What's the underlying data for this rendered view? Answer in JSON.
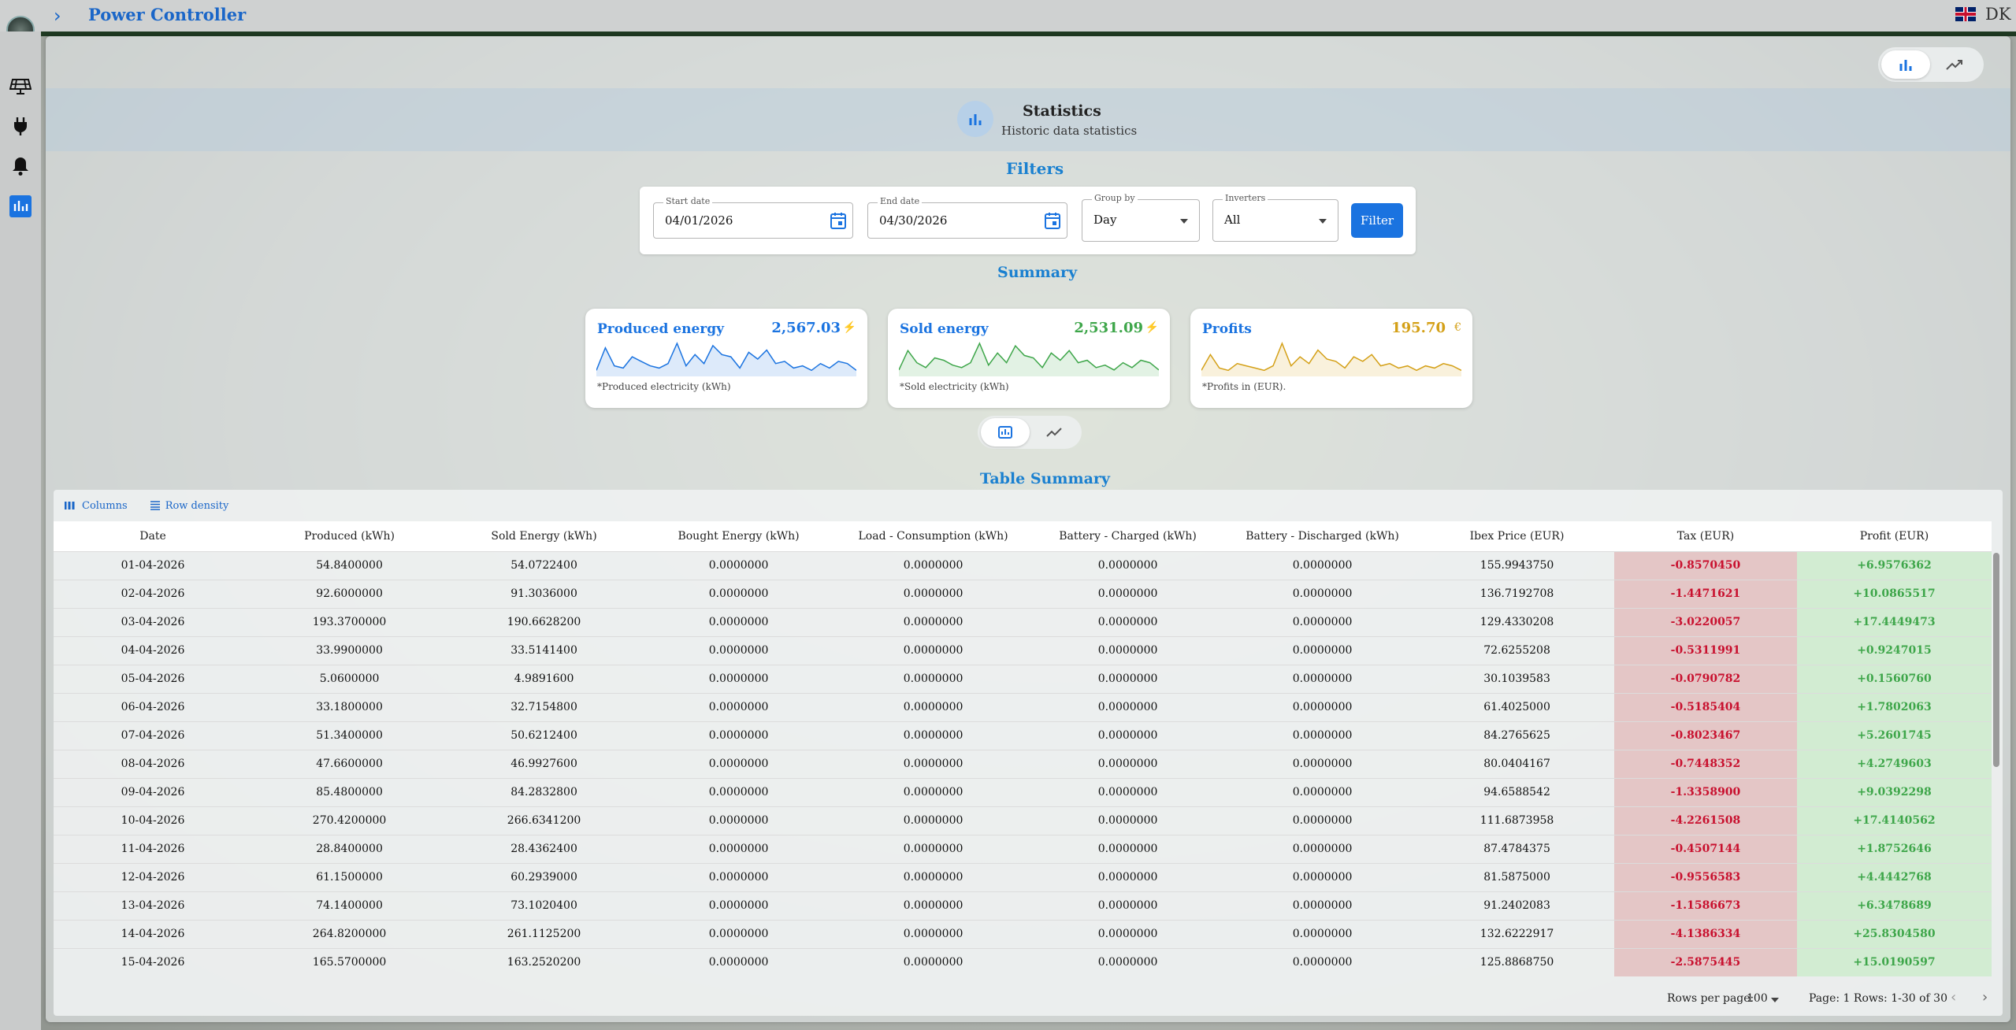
{
  "app": {
    "title": "Power Controller",
    "lang_code": "DK",
    "chevron": "›"
  },
  "sidebar": {
    "items": [
      "solar-panel-icon",
      "plug-icon",
      "bell-icon",
      "bar-chart-icon"
    ]
  },
  "statistics": {
    "title": "Statistics",
    "subtitle": "Historic data statistics"
  },
  "filters": {
    "title": "Filters",
    "start_label": "Start date",
    "start_value": "04/01/2026",
    "end_label": "End date",
    "end_value": "04/30/2026",
    "group_label": "Group by",
    "group_value": "Day",
    "inverters_label": "Inverters",
    "inverters_value": "All",
    "button": "Filter"
  },
  "summary": {
    "title": "Summary",
    "produced": {
      "label": "Produced energy",
      "value": "2,567.03",
      "unit": "⚡",
      "note": "*Produced electricity (kWh)",
      "color": "#1a73e0",
      "spark": [
        2,
        12,
        4,
        3,
        8,
        6,
        4,
        3,
        5,
        14,
        4,
        9,
        5,
        13,
        9,
        8,
        3,
        10,
        7,
        11,
        5,
        6,
        3,
        4,
        2,
        5,
        3,
        6,
        5,
        2
      ]
    },
    "sold": {
      "label": "Sold energy",
      "value": "2,531.09",
      "unit": "⚡",
      "note": "*Sold electricity (kWh)",
      "color": "#3ea64a",
      "spark": [
        2,
        10,
        5,
        3,
        7,
        6,
        4,
        3,
        5,
        13,
        4,
        9,
        5,
        12,
        8,
        7,
        3,
        9,
        6,
        10,
        5,
        6,
        3,
        4,
        2,
        5,
        3,
        6,
        5,
        2
      ]
    },
    "profits": {
      "label": "Profits",
      "value": "195.70",
      "unit": "€",
      "note": "*Profits in (EUR).",
      "color": "#d4a017",
      "spark": [
        2,
        9,
        3,
        2,
        5,
        4,
        3,
        2,
        4,
        14,
        4,
        8,
        5,
        11,
        7,
        6,
        3,
        8,
        6,
        9,
        4,
        5,
        3,
        4,
        2,
        4,
        3,
        5,
        4,
        2
      ]
    }
  },
  "table": {
    "title": "Table Summary",
    "columns_btn": "Columns",
    "density_btn": "Row density",
    "headers": [
      "Date",
      "Produced (kWh)",
      "Sold Energy (kWh)",
      "Bought Energy (kWh)",
      "Load - Consumption (kWh)",
      "Battery - Charged (kWh)",
      "Battery - Discharged (kWh)",
      "Ibex Price (EUR)",
      "Tax (EUR)",
      "Profit (EUR)"
    ],
    "rows": [
      [
        "01-04-2026",
        "54.8400000",
        "54.0722400",
        "0.0000000",
        "0.0000000",
        "0.0000000",
        "0.0000000",
        "155.9943750",
        "-0.8570450",
        "+6.9576362"
      ],
      [
        "02-04-2026",
        "92.6000000",
        "91.3036000",
        "0.0000000",
        "0.0000000",
        "0.0000000",
        "0.0000000",
        "136.7192708",
        "-1.4471621",
        "+10.0865517"
      ],
      [
        "03-04-2026",
        "193.3700000",
        "190.6628200",
        "0.0000000",
        "0.0000000",
        "0.0000000",
        "0.0000000",
        "129.4330208",
        "-3.0220057",
        "+17.4449473"
      ],
      [
        "04-04-2026",
        "33.9900000",
        "33.5141400",
        "0.0000000",
        "0.0000000",
        "0.0000000",
        "0.0000000",
        "72.6255208",
        "-0.5311991",
        "+0.9247015"
      ],
      [
        "05-04-2026",
        "5.0600000",
        "4.9891600",
        "0.0000000",
        "0.0000000",
        "0.0000000",
        "0.0000000",
        "30.1039583",
        "-0.0790782",
        "+0.1560760"
      ],
      [
        "06-04-2026",
        "33.1800000",
        "32.7154800",
        "0.0000000",
        "0.0000000",
        "0.0000000",
        "0.0000000",
        "61.4025000",
        "-0.5185404",
        "+1.7802063"
      ],
      [
        "07-04-2026",
        "51.3400000",
        "50.6212400",
        "0.0000000",
        "0.0000000",
        "0.0000000",
        "0.0000000",
        "84.2765625",
        "-0.8023467",
        "+5.2601745"
      ],
      [
        "08-04-2026",
        "47.6600000",
        "46.9927600",
        "0.0000000",
        "0.0000000",
        "0.0000000",
        "0.0000000",
        "80.0404167",
        "-0.7448352",
        "+4.2749603"
      ],
      [
        "09-04-2026",
        "85.4800000",
        "84.2832800",
        "0.0000000",
        "0.0000000",
        "0.0000000",
        "0.0000000",
        "94.6588542",
        "-1.3358900",
        "+9.0392298"
      ],
      [
        "10-04-2026",
        "270.4200000",
        "266.6341200",
        "0.0000000",
        "0.0000000",
        "0.0000000",
        "0.0000000",
        "111.6873958",
        "-4.2261508",
        "+17.4140562"
      ],
      [
        "11-04-2026",
        "28.8400000",
        "28.4362400",
        "0.0000000",
        "0.0000000",
        "0.0000000",
        "0.0000000",
        "87.4784375",
        "-0.4507144",
        "+1.8752646"
      ],
      [
        "12-04-2026",
        "61.1500000",
        "60.2939000",
        "0.0000000",
        "0.0000000",
        "0.0000000",
        "0.0000000",
        "81.5875000",
        "-0.9556583",
        "+4.4442768"
      ],
      [
        "13-04-2026",
        "74.1400000",
        "73.1020400",
        "0.0000000",
        "0.0000000",
        "0.0000000",
        "0.0000000",
        "91.2402083",
        "-1.1586673",
        "+6.3478689"
      ],
      [
        "14-04-2026",
        "264.8200000",
        "261.1125200",
        "0.0000000",
        "0.0000000",
        "0.0000000",
        "0.0000000",
        "132.6222917",
        "-4.1386334",
        "+25.8304580"
      ],
      [
        "15-04-2026",
        "165.5700000",
        "163.2520200",
        "0.0000000",
        "0.0000000",
        "0.0000000",
        "0.0000000",
        "125.8868750",
        "-2.5875445",
        "+15.0190597"
      ]
    ],
    "footer": {
      "rows_per_page_label": "Rows per page:",
      "rows_per_page": "100",
      "page_info": "Page: 1 Rows: 1-30 of 30",
      "prev": "‹",
      "next": "›"
    }
  }
}
